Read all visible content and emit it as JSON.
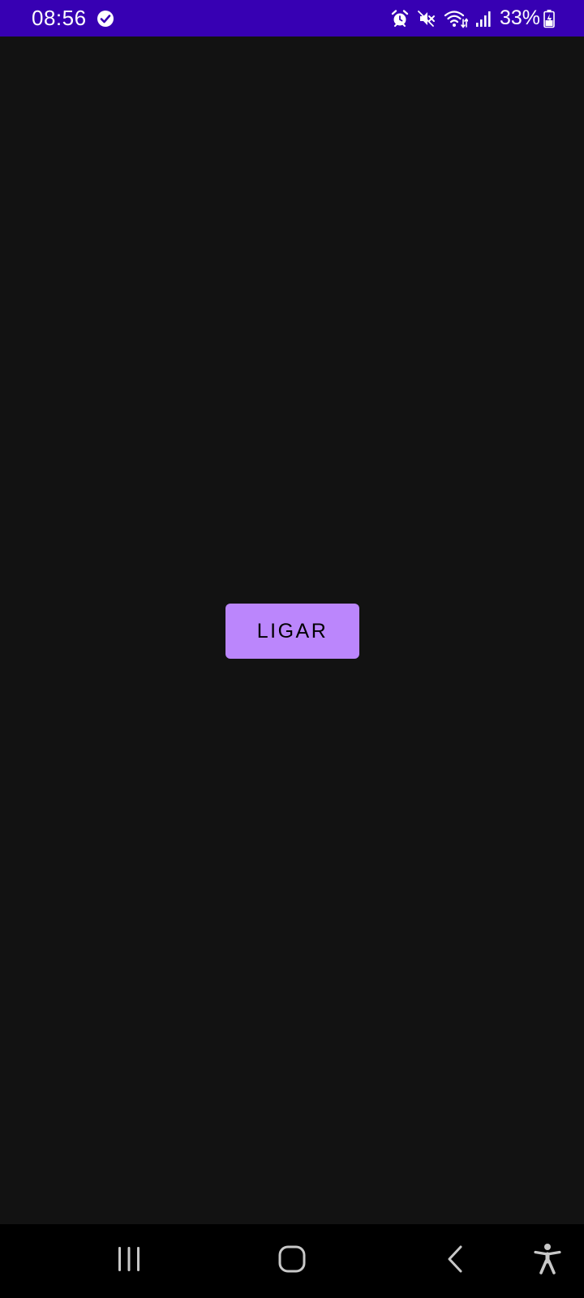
{
  "status_bar": {
    "time": "08:56",
    "battery_percent": "33%",
    "icons": [
      "check-circle-icon",
      "alarm-icon",
      "mute-icon",
      "wifi-icon",
      "signal-icon",
      "battery-charging-icon"
    ],
    "background": "#3700b3"
  },
  "main": {
    "button_label": "LIGAR",
    "button_color": "#bb86fc",
    "background": "#121212"
  },
  "nav_bar": {
    "buttons": [
      "recents-icon",
      "home-icon",
      "back-icon",
      "accessibility-icon"
    ]
  }
}
